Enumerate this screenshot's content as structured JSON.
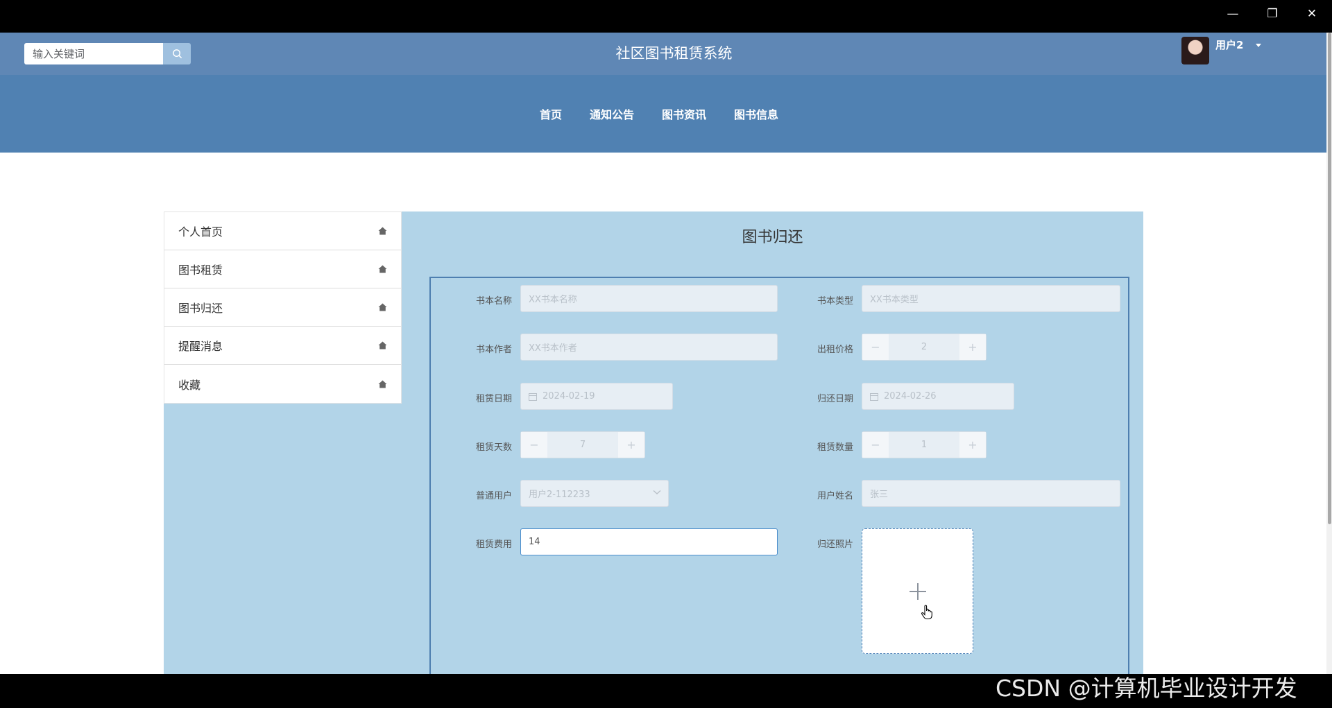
{
  "window": {
    "minimize": "—",
    "restore": "❐",
    "close": "✕"
  },
  "header": {
    "search_placeholder": "输入关键词",
    "site_title": "社区图书租赁系统",
    "username": "用户2"
  },
  "nav": [
    "首页",
    "通知公告",
    "图书资讯",
    "图书信息"
  ],
  "sidebar": {
    "items": [
      {
        "label": "个人首页",
        "icon": "home-icon"
      },
      {
        "label": "图书租赁",
        "icon": "home-icon"
      },
      {
        "label": "图书归还",
        "icon": "home-icon"
      },
      {
        "label": "提醒消息",
        "icon": "home-icon"
      },
      {
        "label": "收藏",
        "icon": "home-icon"
      }
    ]
  },
  "form": {
    "title": "图书归还",
    "book_name": {
      "label": "书本名称",
      "placeholder": "XX书本名称"
    },
    "book_type": {
      "label": "书本类型",
      "placeholder": "XX书本类型"
    },
    "book_author": {
      "label": "书本作者",
      "placeholder": "XX书本作者"
    },
    "rent_price": {
      "label": "出租价格",
      "value": "2"
    },
    "rent_date": {
      "label": "租赁日期",
      "value": "2024-02-19"
    },
    "return_date": {
      "label": "归还日期",
      "value": "2024-02-26"
    },
    "rent_days": {
      "label": "租赁天数",
      "value": "7"
    },
    "rent_qty": {
      "label": "租赁数量",
      "value": "1"
    },
    "user": {
      "label": "普通用户",
      "value": "用户2-112233"
    },
    "user_name": {
      "label": "用户姓名",
      "value": "张三"
    },
    "rent_fee": {
      "label": "租赁费用",
      "value": "14"
    },
    "return_photo": {
      "label": "归还照片"
    }
  },
  "watermark": "CSDN @计算机毕业设计开发"
}
